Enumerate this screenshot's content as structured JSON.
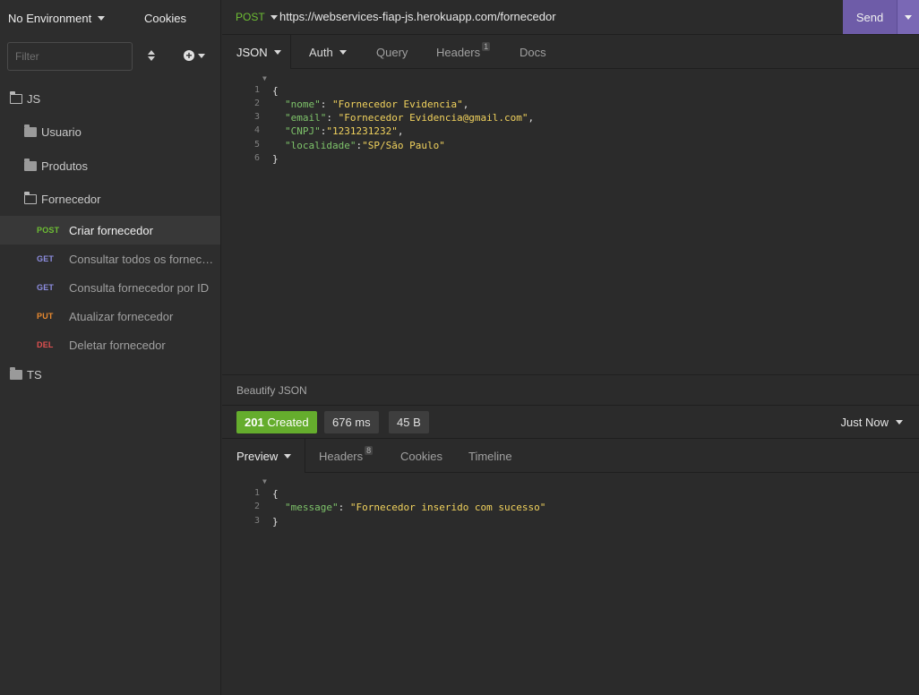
{
  "sidebar": {
    "environment": "No Environment",
    "cookies": "Cookies",
    "filter_placeholder": "Filter",
    "folders": {
      "js": "JS",
      "usuario": "Usuario",
      "produtos": "Produtos",
      "fornecedor": "Fornecedor",
      "ts": "TS"
    },
    "requests": [
      {
        "method": "POST",
        "name": "Criar fornecedor"
      },
      {
        "method": "GET",
        "name": "Consultar todos os fornecedores"
      },
      {
        "method": "GET",
        "name": "Consulta fornecedor por ID"
      },
      {
        "method": "PUT",
        "name": "Atualizar fornecedor"
      },
      {
        "method": "DEL",
        "name": "Deletar fornecedor"
      }
    ]
  },
  "request": {
    "method": "POST",
    "url": "https://webservices-fiap-js.herokuapp.com/fornecedor",
    "send_label": "Send",
    "tabs": {
      "body": "JSON",
      "auth": "Auth",
      "query": "Query",
      "headers": "Headers",
      "headers_count": "1",
      "docs": "Docs"
    },
    "body_lines": [
      {
        "n": "1",
        "open": "{"
      },
      {
        "n": "2",
        "key": "\"nome\"",
        "sep": ": ",
        "val": "\"Fornecedor Evidencia\"",
        "end": ","
      },
      {
        "n": "3",
        "key": "\"email\"",
        "sep": ": ",
        "val": "\"Fornecedor Evidencia@gmail.com\"",
        "end": ","
      },
      {
        "n": "4",
        "key": "\"CNPJ\"",
        "sep": ":",
        "val": "\"1231231232\"",
        "end": ","
      },
      {
        "n": "5",
        "key": "\"localidade\"",
        "sep": ":",
        "val": "\"SP/São Paulo\"",
        "end": ""
      },
      {
        "n": "6",
        "open": "}"
      }
    ],
    "beautify": "Beautify JSON"
  },
  "response": {
    "status_code": "201",
    "status_text": "Created",
    "time": "676 ms",
    "size": "45 B",
    "when": "Just Now",
    "tabs": {
      "preview": "Preview",
      "headers": "Headers",
      "headers_count": "8",
      "cookies": "Cookies",
      "timeline": "Timeline"
    },
    "body_lines": [
      {
        "n": "1",
        "open": "{"
      },
      {
        "n": "2",
        "key": "\"message\"",
        "sep": ": ",
        "val": "\"Fornecedor inserido com sucesso\"",
        "end": ""
      },
      {
        "n": "3",
        "open": "}"
      }
    ]
  },
  "colors": {
    "post": "#6ebf34",
    "get": "#8d8de0",
    "put": "#e8892f",
    "del": "#e05050",
    "send": "#6e5ca8",
    "success": "#65ad2d"
  }
}
